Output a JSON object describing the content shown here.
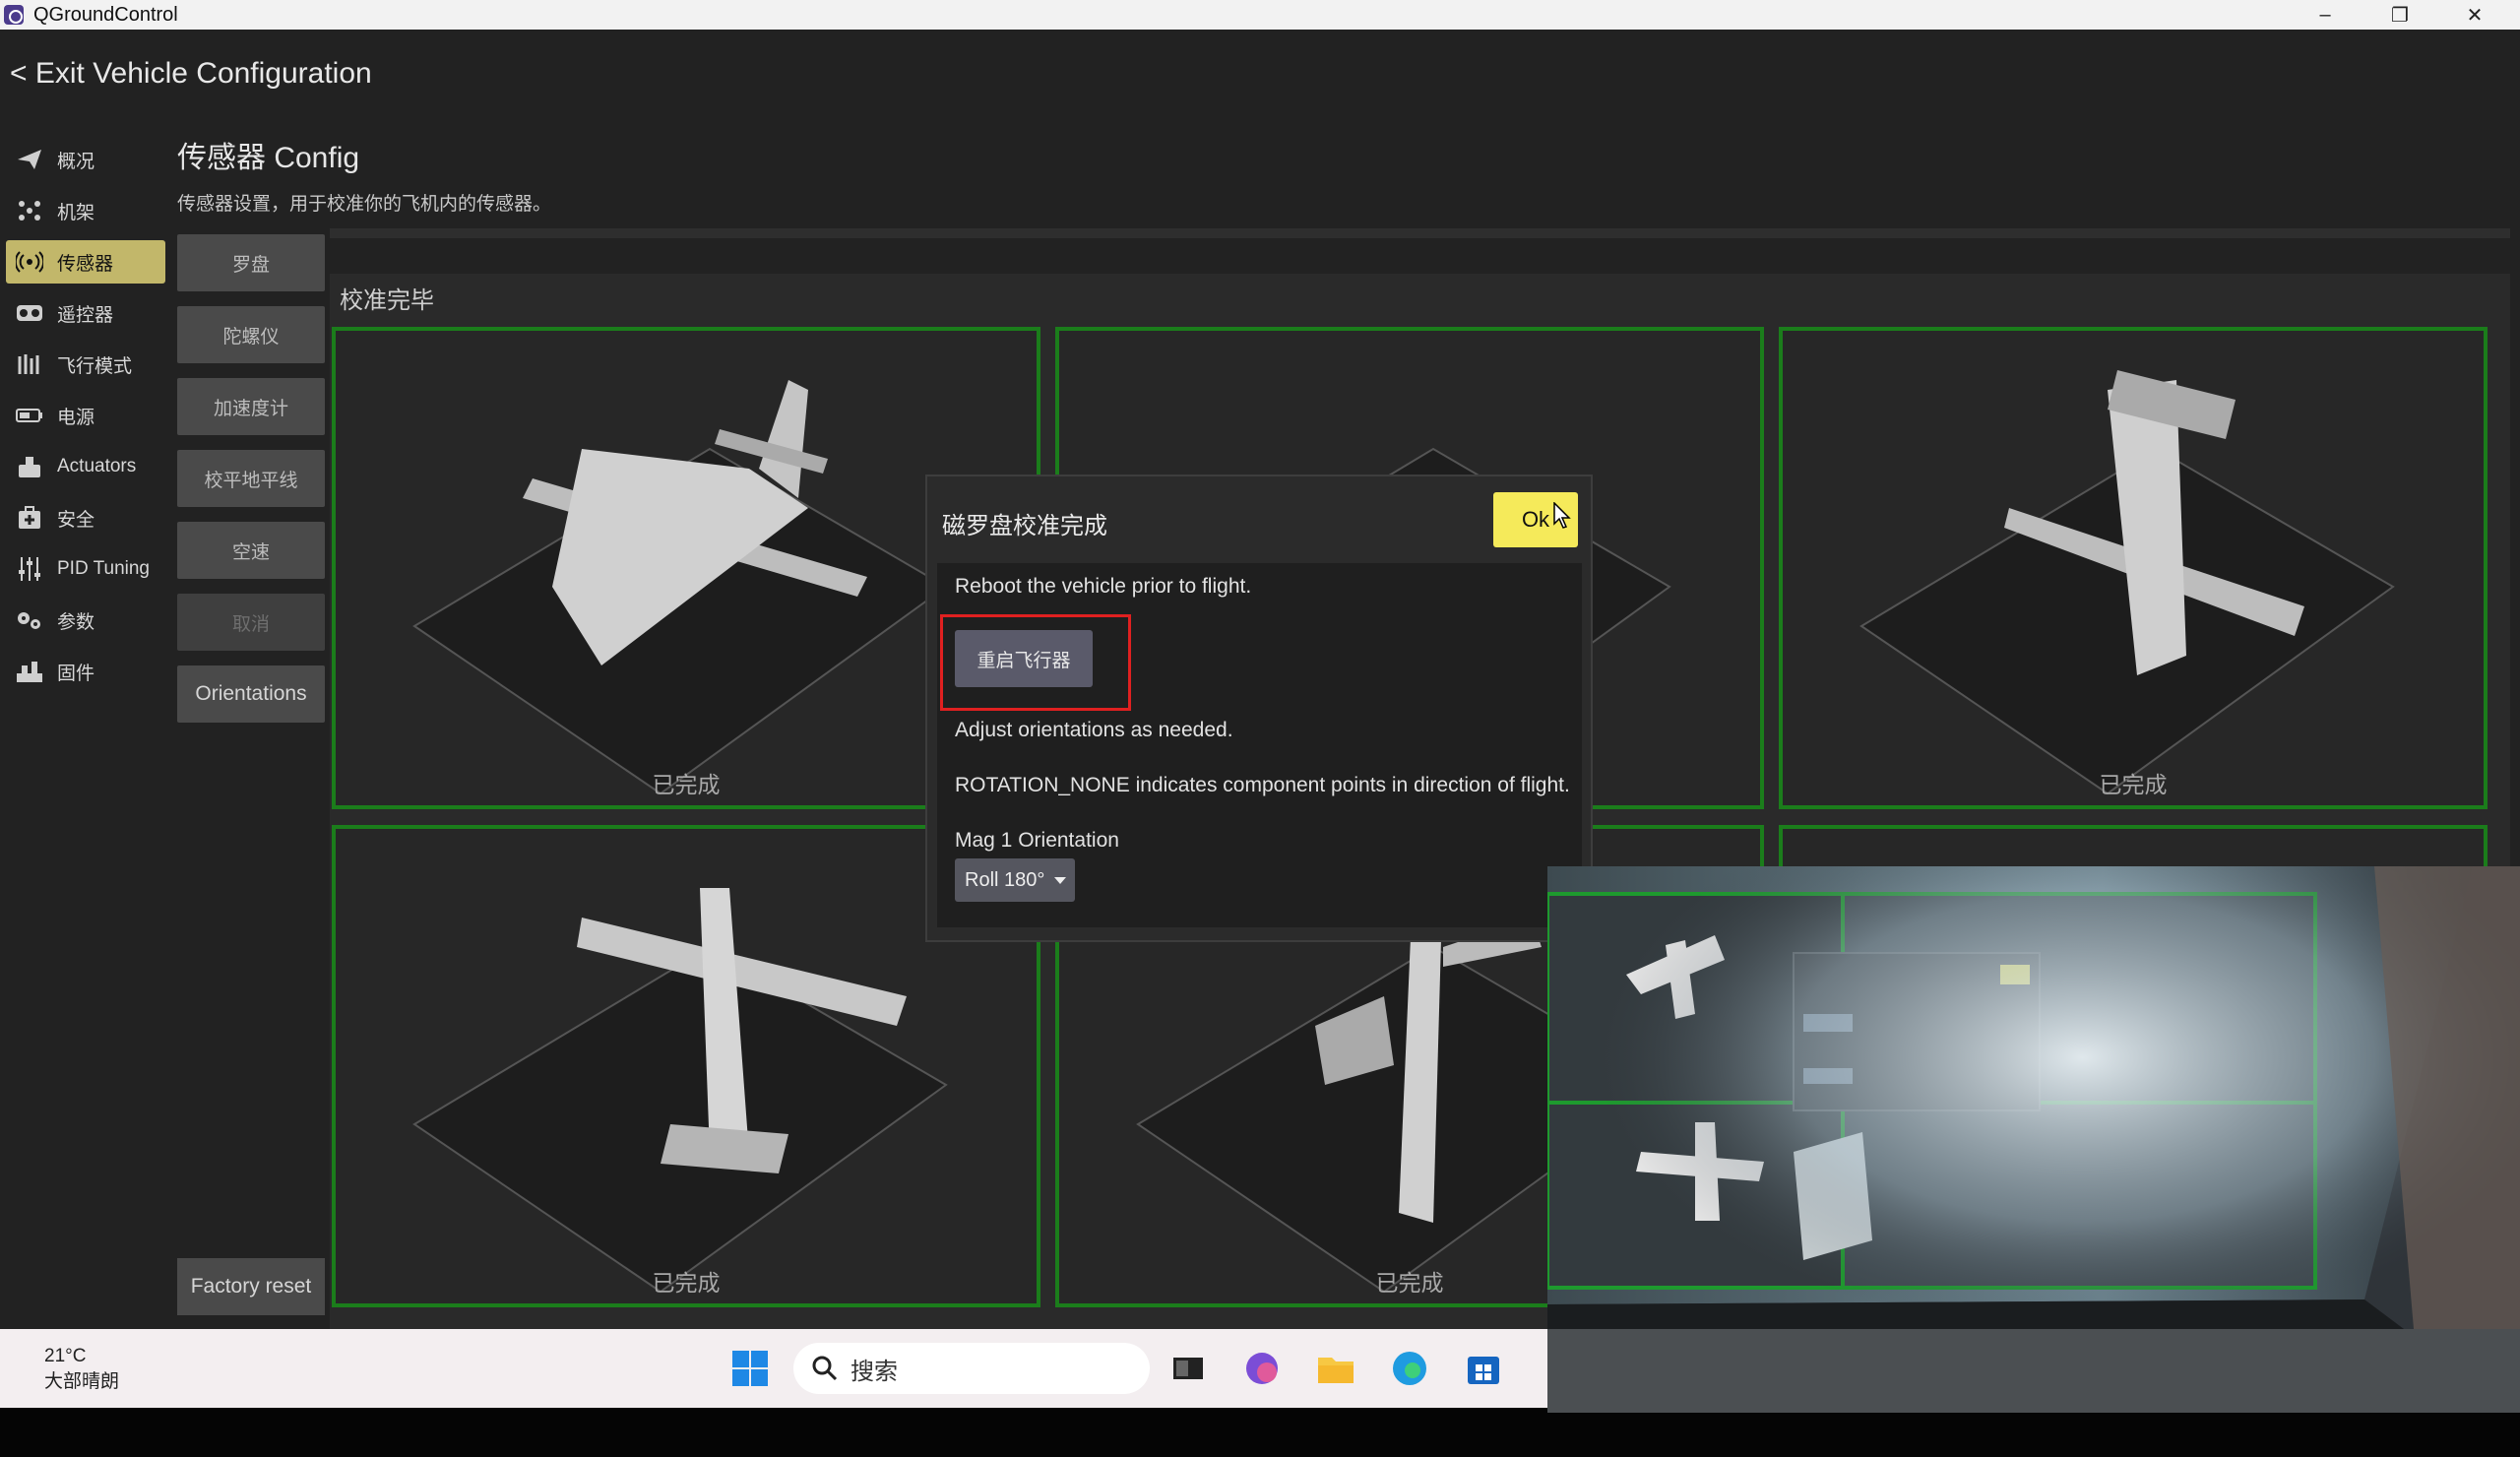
{
  "window": {
    "title": "QGroundControl",
    "controls": {
      "minimize": "–",
      "restore": "❐",
      "close": "✕"
    }
  },
  "header": {
    "exit_label": "< Exit Vehicle Configuration"
  },
  "sidebar": {
    "items": [
      {
        "label": "概况",
        "icon": "paper-plane-icon"
      },
      {
        "label": "机架",
        "icon": "airframe-icon"
      },
      {
        "label": "传感器",
        "icon": "sensor-icon",
        "active": true
      },
      {
        "label": "遥控器",
        "icon": "radio-icon"
      },
      {
        "label": "飞行模式",
        "icon": "flight-modes-icon"
      },
      {
        "label": "电源",
        "icon": "battery-icon"
      },
      {
        "label": "Actuators",
        "icon": "actuators-icon"
      },
      {
        "label": "安全",
        "icon": "safety-icon"
      },
      {
        "label": "PID Tuning",
        "icon": "sliders-icon"
      },
      {
        "label": "参数",
        "icon": "gears-icon"
      },
      {
        "label": "固件",
        "icon": "firmware-icon"
      }
    ]
  },
  "page": {
    "title": "传感器 Config",
    "subtitle": "传感器设置，用于校准你的飞机内的传感器。"
  },
  "subnav": {
    "compass": "罗盘",
    "gyro": "陀螺仪",
    "accel": "加速度计",
    "level": "校平地平线",
    "airspeed": "空速",
    "cancel": "取消",
    "orientations": "Orientations",
    "factory_reset": "Factory reset"
  },
  "calibration": {
    "status_title": "校准完毕",
    "tile_done_label": "已完成"
  },
  "dialog": {
    "title": "磁罗盘校准完成",
    "ok": "Ok",
    "reboot_text": "Reboot the vehicle prior to flight.",
    "reboot_button": "重启飞行器",
    "adjust_text": "Adjust orientations as needed.",
    "rotation_text": "ROTATION_NONE indicates component points in direction of flight.",
    "mag_label": "Mag 1 Orientation",
    "mag_value": "Roll 180°"
  },
  "taskbar": {
    "weather_temp": "21°C",
    "weather_desc": "大部晴朗",
    "search_placeholder": "搜索"
  },
  "colors": {
    "background": "#222222",
    "active_item": "#c2b76a",
    "tile_border": "#1b7d1b",
    "ok_button": "#f5ea5a",
    "highlight": "#e02020"
  }
}
